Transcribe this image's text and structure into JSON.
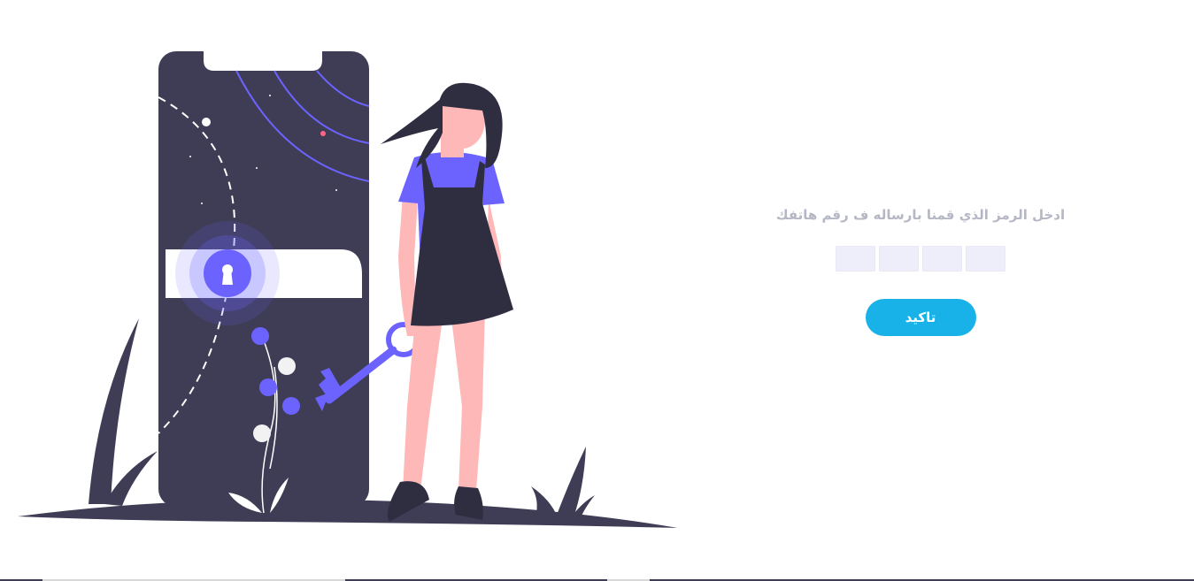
{
  "verify": {
    "instruction": "ادخل الرمز الذي قمنا بارساله ف رقم هاتفك",
    "code_digits": [
      "",
      "",
      "",
      ""
    ],
    "confirm_label": "تاكيد"
  },
  "colors": {
    "accent": "#6c63ff",
    "button": "#19b2e8",
    "dark": "#3f3d56",
    "skin": "#ffb8b8",
    "instruction_text": "#b5b7c4"
  },
  "illustration": {
    "icon": "phone-lock-key-illustration"
  }
}
